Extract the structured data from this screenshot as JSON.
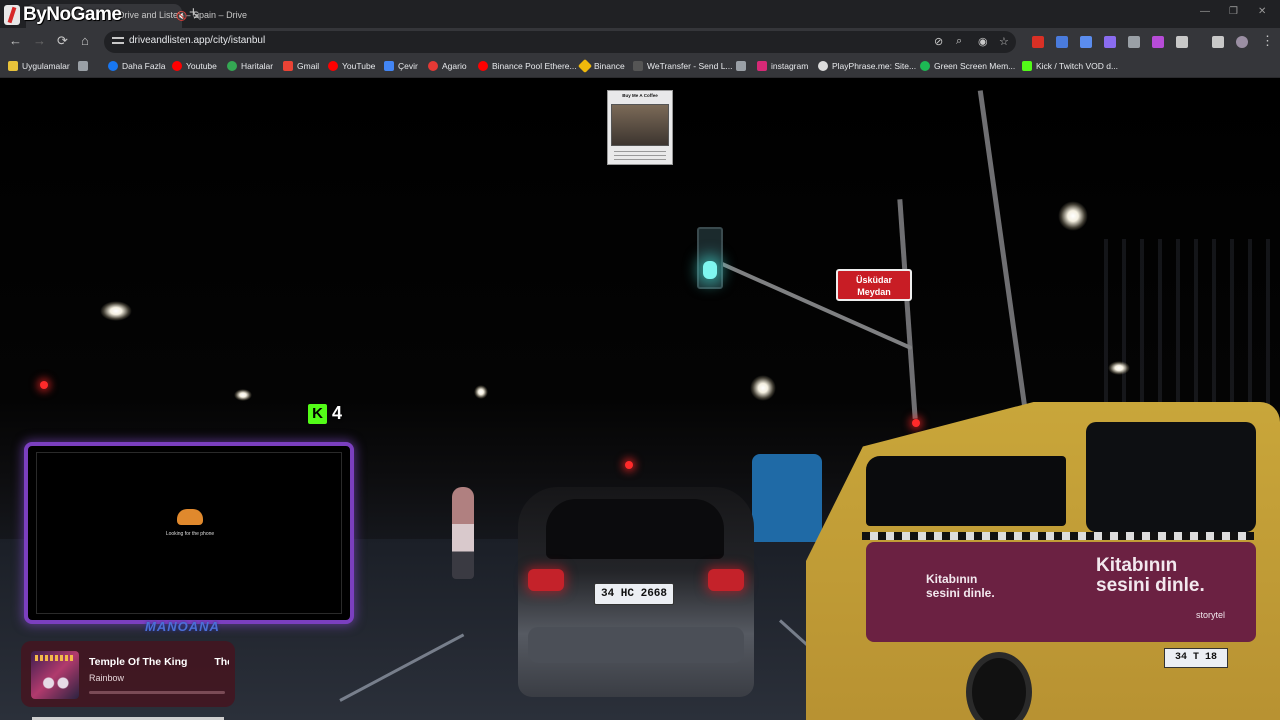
{
  "brand": {
    "name": "ByNoGame"
  },
  "tab": {
    "title": "Drive and Listen – Spain – Drive",
    "close": "×",
    "new_tab": "+"
  },
  "window": {
    "minimize": "—",
    "restore": "❐",
    "close": "✕"
  },
  "toolbar": {
    "back": "←",
    "forward": "→",
    "reload": "⟳",
    "home": "⌂",
    "url": "driveandlisten.app/city/istanbul",
    "icons": [
      "eye-off-icon",
      "zoom-icon",
      "visibility-icon",
      "star-icon"
    ]
  },
  "extensions": [
    {
      "name": "new-extension",
      "color": "#d93025"
    },
    {
      "name": "translate-extension",
      "color": "#4a7bdc"
    },
    {
      "name": "audio-extension",
      "color": "#5b8dee"
    },
    {
      "name": "pen-extension",
      "color": "#8a6cf0"
    },
    {
      "name": "screenshot-extension",
      "color": "#9aa0a6"
    },
    {
      "name": "purple-extension",
      "color": "#b74cd8"
    },
    {
      "name": "puzzle-extension",
      "color": "#c8c8c8"
    }
  ],
  "bookmarks": [
    {
      "label": "Uygulamalar",
      "color": "#e8c23a",
      "icon": "apps-icon"
    },
    {
      "label": "",
      "color": "#9aa0a6",
      "icon": "grid-icon"
    },
    {
      "label": "Daha Fazla",
      "color": "#1877f2",
      "icon": "facebook-icon"
    },
    {
      "label": "Youtube",
      "color": "#ff0000",
      "icon": "youtube-icon"
    },
    {
      "label": "Haritalar",
      "color": "#34a853",
      "icon": "maps-icon"
    },
    {
      "label": "Gmail",
      "color": "#ea4335",
      "icon": "gmail-icon"
    },
    {
      "label": "YouTube",
      "color": "#ff0000",
      "icon": "youtube-icon"
    },
    {
      "label": "Çevir",
      "color": "#4285f4",
      "icon": "translate-icon"
    },
    {
      "label": "Agario",
      "color": "#e53935",
      "icon": "agario-icon"
    },
    {
      "label": "Binance Pool Ethere...",
      "color": "#ff0000",
      "icon": "youtube-icon"
    },
    {
      "label": "Binance",
      "color": "#f0b90b",
      "icon": "binance-icon"
    },
    {
      "label": "WeTransfer - Send L...",
      "color": "#555555",
      "icon": "wetransfer-icon"
    },
    {
      "label": "",
      "color": "#9aa0a6",
      "icon": "doc-icon"
    },
    {
      "label": "instagram",
      "color": "#d62976",
      "icon": "instagram-icon"
    },
    {
      "label": "PlayPhrase.me: Site...",
      "color": "#dddddd",
      "icon": "playphrase-icon"
    },
    {
      "label": "Green Screen Mem...",
      "color": "#1db954",
      "icon": "greenscreen-icon"
    },
    {
      "label": "Kick / Twitch VOD d...",
      "color": "#53fc18",
      "icon": "kick-icon"
    }
  ],
  "scene": {
    "street_sign": "Üsküdar\nMeydan",
    "car_plate": "34 HC 2668",
    "taxi_plate": "34 T 18",
    "taxi_ad": {
      "big": "Kitabının\nsesini dinle.",
      "mid": "Kitabının\nsesini dinle.",
      "small": "storytel"
    }
  },
  "overlay": {
    "kick_logo": "K",
    "kick_count": "4",
    "donation_title": "Buy Me A Coffee",
    "cam_loading": "Looking for the phone",
    "cam_label": "MANOANA",
    "music": {
      "title": "Temple Of The King",
      "title_next": "The",
      "artist": "Rainbow",
      "progress": 0
    }
  }
}
